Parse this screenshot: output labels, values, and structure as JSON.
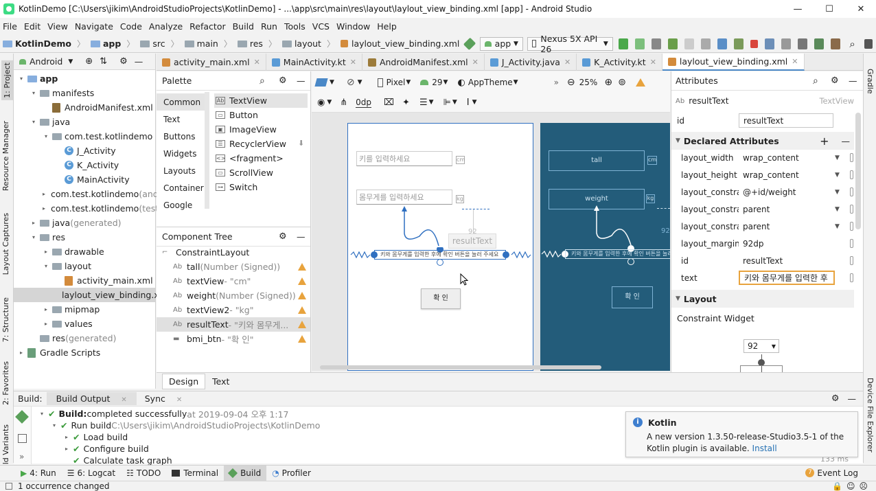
{
  "window": {
    "title": "KotlinDemo [C:\\Users\\jikim\\AndroidStudioProjects\\KotlinDemo] - ...\\app\\src\\main\\res\\layout\\laylout_view_binding.xml [app] - Android Studio",
    "minimize": "—",
    "maximize": "☐",
    "close": "✕"
  },
  "menu": [
    "File",
    "Edit",
    "View",
    "Navigate",
    "Code",
    "Analyze",
    "Refactor",
    "Build",
    "Run",
    "Tools",
    "VCS",
    "Window",
    "Help"
  ],
  "breadcrumb": [
    "KotlinDemo",
    "app",
    "src",
    "main",
    "res",
    "layout",
    "laylout_view_binding.xml"
  ],
  "run_config": "app",
  "device": "Nexus 5X API 26",
  "left_tabs": [
    "1: Project",
    "Resource Manager",
    "Layout Captures",
    "7: Structure",
    "2: Favorites",
    "Build Variants"
  ],
  "right_tabs": [
    "Gradle",
    "Device File Explorer"
  ],
  "project": {
    "view": "Android",
    "rows": [
      {
        "label": "app",
        "indent": 0,
        "arrow": "▾",
        "kind": "folder-blue",
        "bold": true
      },
      {
        "label": "manifests",
        "indent": 1,
        "arrow": "▾",
        "kind": "folder"
      },
      {
        "label": "AndroidManifest.xml",
        "indent": 2,
        "arrow": "",
        "kind": "manifest"
      },
      {
        "label": "java",
        "indent": 1,
        "arrow": "▾",
        "kind": "folder"
      },
      {
        "label": "com.test.kotlindemo",
        "indent": 2,
        "arrow": "▾",
        "kind": "folder"
      },
      {
        "label": "J_Activity",
        "indent": 3,
        "arrow": "",
        "kind": "class"
      },
      {
        "label": "K_Activity",
        "indent": 3,
        "arrow": "",
        "kind": "class"
      },
      {
        "label": "MainActivity",
        "indent": 3,
        "arrow": "",
        "kind": "class"
      },
      {
        "label": "com.test.kotlindemo",
        "suffix": " (androidT",
        "indent": 2,
        "arrow": "▸",
        "kind": "folder"
      },
      {
        "label": "com.test.kotlindemo",
        "suffix": " (test)",
        "indent": 2,
        "arrow": "▸",
        "kind": "folder"
      },
      {
        "label": "java",
        "suffix": " (generated)",
        "indent": 1,
        "arrow": "▸",
        "kind": "folder"
      },
      {
        "label": "res",
        "indent": 1,
        "arrow": "▾",
        "kind": "folder"
      },
      {
        "label": "drawable",
        "indent": 2,
        "arrow": "▸",
        "kind": "folder"
      },
      {
        "label": "layout",
        "indent": 2,
        "arrow": "▾",
        "kind": "folder"
      },
      {
        "label": "activity_main.xml",
        "indent": 3,
        "arrow": "",
        "kind": "xml"
      },
      {
        "label": "laylout_view_binding.xml",
        "indent": 3,
        "arrow": "",
        "kind": "xml",
        "selected": true
      },
      {
        "label": "mipmap",
        "indent": 2,
        "arrow": "▸",
        "kind": "folder"
      },
      {
        "label": "values",
        "indent": 2,
        "arrow": "▸",
        "kind": "folder"
      },
      {
        "label": "res",
        "suffix": " (generated)",
        "indent": 1,
        "arrow": "",
        "kind": "folder"
      },
      {
        "label": "Gradle Scripts",
        "indent": 0,
        "arrow": "▸",
        "kind": "gradle"
      }
    ]
  },
  "editor_tabs": [
    {
      "label": "activity_main.xml",
      "color": "#d38b3c"
    },
    {
      "label": "MainActivity.kt",
      "color": "#5a9bd6"
    },
    {
      "label": "AndroidManifest.xml",
      "color": "#9c7b3a"
    },
    {
      "label": "J_Activity.java",
      "color": "#5a9bd6"
    },
    {
      "label": "K_Activity.kt",
      "color": "#5a9bd6"
    },
    {
      "label": "laylout_view_binding.xml",
      "color": "#d38b3c",
      "active": true
    }
  ],
  "palette": {
    "title": "Palette",
    "categories": [
      "Common",
      "Text",
      "Buttons",
      "Widgets",
      "Layouts",
      "Container",
      "Google"
    ],
    "items": [
      "TextView",
      "Button",
      "ImageView",
      "RecyclerView",
      "<fragment>",
      "ScrollView",
      "Switch"
    ]
  },
  "component_tree": {
    "title": "Component Tree",
    "rows": [
      {
        "label": "ConstraintLayout",
        "note": "",
        "indent": 0
      },
      {
        "label": "tall",
        "note": "(Number (Signed))",
        "indent": 1,
        "warn": true
      },
      {
        "label": "textView",
        "note": "- \"cm\"",
        "indent": 1,
        "warn": true
      },
      {
        "label": "weight",
        "note": "(Number (Signed))",
        "indent": 1,
        "warn": true
      },
      {
        "label": "textView2",
        "note": "- \"kg\"",
        "indent": 1,
        "warn": true
      },
      {
        "label": "resultText",
        "note": "- \"키와 몸무게...",
        "indent": 1,
        "warn": true,
        "selected": true
      },
      {
        "label": "bmi_btn",
        "note": "- \"확 인\"",
        "indent": 1,
        "warn": true
      }
    ]
  },
  "design_toolbar": {
    "device": "Pixel",
    "api": "29",
    "theme": "AppTheme",
    "zoom": "25%",
    "margin": "0dp"
  },
  "canvas": {
    "tall_hint": "키를 입력하세요",
    "cm": "cm",
    "weight_hint": "몸무게를 입력하세요",
    "kg": "kg",
    "result_label": "resultText",
    "result_margin": "92",
    "result_text": "키와 몸무게를 입력한 후에 확인 버튼을 눌러 주세요",
    "button": "확 인",
    "bp_tall": "tall",
    "bp_weight": "weight",
    "bp_margin": "92"
  },
  "attributes": {
    "title": "Attributes",
    "selected": "resultText",
    "selected_type": "TextView",
    "id_label": "id",
    "id_value": "resultText",
    "declared_title": "Declared Attributes",
    "declared": [
      {
        "k": "layout_width",
        "v": "wrap_content",
        "dd": true
      },
      {
        "k": "layout_height",
        "v": "wrap_content",
        "dd": true
      },
      {
        "k": "layout_constraintT",
        "v": "@+id/weight",
        "dd": true
      },
      {
        "k": "layout_constraintE",
        "v": "parent",
        "dd": true
      },
      {
        "k": "layout_constraintS",
        "v": "parent",
        "dd": true
      },
      {
        "k": "layout_marginTop",
        "v": "92dp",
        "dd": false
      },
      {
        "k": "id",
        "v": "resultText",
        "dd": false
      },
      {
        "k": "text",
        "v": "키와 몸무게를 입력한 후",
        "dd": false,
        "editing": true
      }
    ],
    "layout_title": "Layout",
    "constraint_widget": "Constraint Widget",
    "margin_value": "92"
  },
  "design_tabs": [
    "Design",
    "Text"
  ],
  "build": {
    "tabs": [
      "Build:",
      "Build Output",
      "Sync"
    ],
    "rows": [
      {
        "bold": "Build:",
        "text": " completed successfully",
        "gray": " at 2019-09-04 오후 1:17",
        "indent": 0,
        "arrow": "▾"
      },
      {
        "text": "Run build",
        "gray": " C:\\Users\\jikim\\AndroidStudioProjects\\KotlinDemo",
        "indent": 1,
        "arrow": "▾"
      },
      {
        "text": "Load build",
        "indent": 2,
        "arrow": "▸"
      },
      {
        "text": "Configure build",
        "indent": 2,
        "arrow": "▸"
      },
      {
        "text": "Calculate task graph",
        "indent": 2,
        "arrow": ""
      }
    ],
    "duration": "133 ms"
  },
  "notification": {
    "title": "Kotlin",
    "body": "A new version 1.3.50-release-Studio3.5-1 of the Kotlin plugin is available.",
    "link": "Install"
  },
  "bottom_tabs": [
    "4: Run",
    "6: Logcat",
    "TODO",
    "Terminal",
    "Build",
    "Profiler"
  ],
  "event_log": {
    "count": "7",
    "label": "Event Log"
  },
  "status": "1 occurrence changed"
}
